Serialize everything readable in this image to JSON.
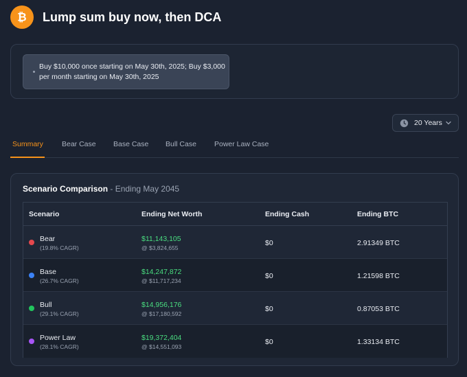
{
  "header": {
    "title": "Lump sum buy now, then DCA",
    "logo_icon": "bitcoin-icon",
    "logo_color": "#f7931a"
  },
  "strategy": {
    "text": "Buy $10,000 once starting on May 30th, 2025; Buy $3,000 per month starting on May 30th, 2025"
  },
  "timeframe": {
    "selected": "20 Years",
    "icon": "clock-icon"
  },
  "tabs": [
    {
      "label": "Summary",
      "active": true
    },
    {
      "label": "Bear Case",
      "active": false
    },
    {
      "label": "Base Case",
      "active": false
    },
    {
      "label": "Bull Case",
      "active": false
    },
    {
      "label": "Power Law Case",
      "active": false
    }
  ],
  "comparison": {
    "title": "Scenario Comparison",
    "subtitle": " - Ending May 2045",
    "columns": [
      "Scenario",
      "Ending Net Worth",
      "Ending Cash",
      "Ending BTC"
    ],
    "rows": [
      {
        "name": "Bear",
        "cagr": "(19.8% CAGR)",
        "color": "#e5484d",
        "net_worth": "$11,143,105",
        "net_worth_sub": "@ $3,824,655",
        "cash": "$0",
        "btc": "2.91349 BTC"
      },
      {
        "name": "Base",
        "cagr": "(26.7% CAGR)",
        "color": "#3b82f6",
        "net_worth": "$14,247,872",
        "net_worth_sub": "@ $11,717,234",
        "cash": "$0",
        "btc": "1.21598 BTC"
      },
      {
        "name": "Bull",
        "cagr": "(29.1% CAGR)",
        "color": "#22c55e",
        "net_worth": "$14,956,176",
        "net_worth_sub": "@ $17,180,592",
        "cash": "$0",
        "btc": "0.87053 BTC"
      },
      {
        "name": "Power Law",
        "cagr": "(28.1% CAGR)",
        "color": "#a855f7",
        "net_worth": "$19,372,404",
        "net_worth_sub": "@ $14,551,093",
        "cash": "$0",
        "btc": "1.33134 BTC"
      }
    ]
  }
}
